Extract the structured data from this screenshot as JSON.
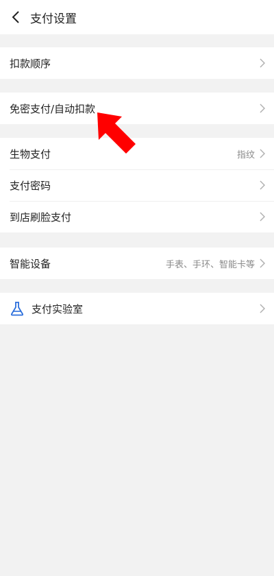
{
  "header": {
    "title": "支付设置",
    "back_icon": "chevron-left-icon"
  },
  "groups": [
    {
      "rows": [
        {
          "label": "扣款顺序",
          "value": ""
        }
      ]
    },
    {
      "rows": [
        {
          "label": "免密支付/自动扣款",
          "value": ""
        }
      ]
    },
    {
      "rows": [
        {
          "label": "生物支付",
          "value": "指纹"
        },
        {
          "label": "支付密码",
          "value": ""
        },
        {
          "label": "到店刷脸支付",
          "value": ""
        }
      ]
    },
    {
      "rows": [
        {
          "label": "智能设备",
          "value": "手表、手环、智能卡等"
        }
      ]
    },
    {
      "rows": [
        {
          "label": "支付实验室",
          "value": "",
          "icon": "flask-icon"
        }
      ]
    }
  ],
  "annotation": {
    "icon": "red-arrow-icon",
    "color": "#ff0000"
  },
  "colors": {
    "accent": "#2c6fdc",
    "background": "#f2f2f2"
  }
}
